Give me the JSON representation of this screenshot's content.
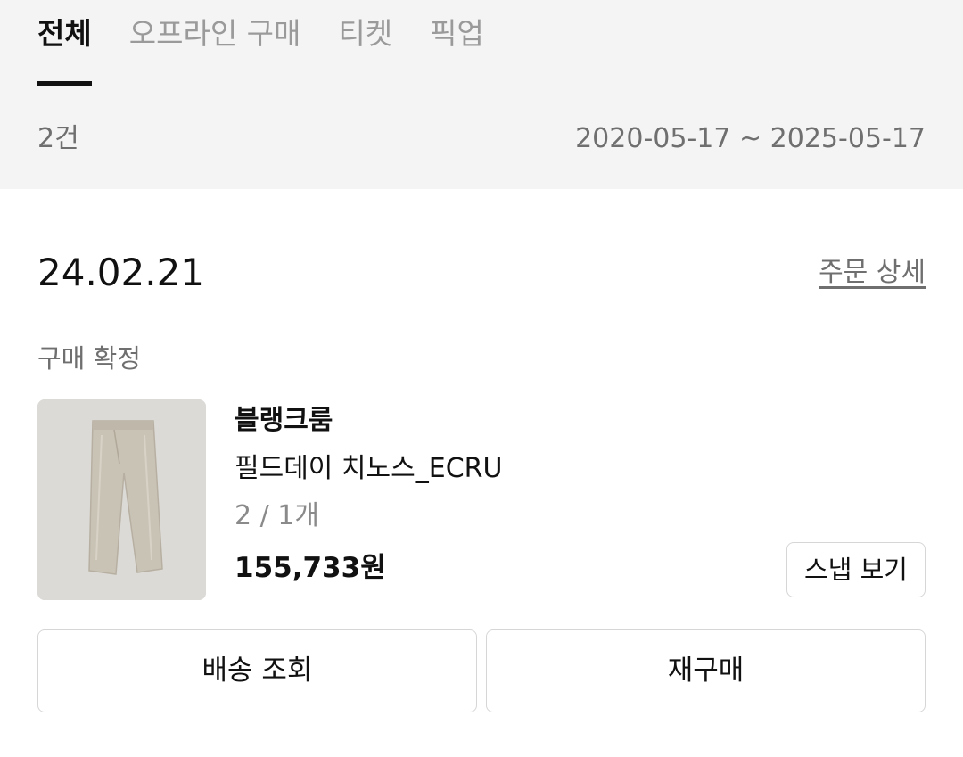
{
  "tabs": [
    {
      "label": "전체",
      "active": true
    },
    {
      "label": "오프라인 구매",
      "active": false
    },
    {
      "label": "티켓",
      "active": false
    },
    {
      "label": "픽업",
      "active": false
    }
  ],
  "summary": {
    "count": "2건",
    "date_range": "2020-05-17 ~ 2025-05-17"
  },
  "order": {
    "date": "24.02.21",
    "detail_link": "주문 상세",
    "status": "구매 확정",
    "product": {
      "thumbnail_icon": "pants-product-image",
      "brand": "블랭크룸",
      "name": "필드데이 치노스_ECRU",
      "option": "2 / 1개",
      "price": "155,733원"
    },
    "snap_button": "스냅 보기",
    "actions": {
      "delivery": "배송 조회",
      "rebuy": "재구매"
    }
  },
  "colors": {
    "header_bg": "#f4f4f4",
    "text_primary": "#111111",
    "text_secondary": "#6f6f6f",
    "border": "#d6d6d6",
    "thumbnail_bg": "#dcdad6"
  }
}
